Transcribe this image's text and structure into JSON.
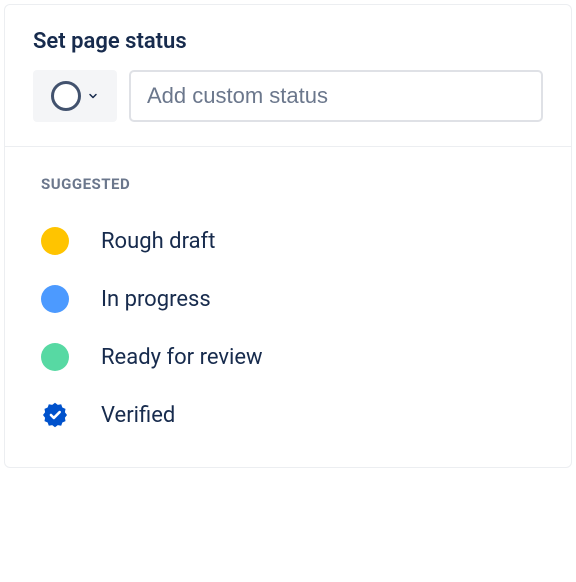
{
  "title": "Set page status",
  "input": {
    "placeholder": "Add custom status",
    "value": ""
  },
  "suggested": {
    "label": "Suggested",
    "items": [
      {
        "label": "Rough draft",
        "color": "#FFC400",
        "type": "dot"
      },
      {
        "label": "In progress",
        "color": "#4C9AFF",
        "type": "dot"
      },
      {
        "label": "Ready for review",
        "color": "#57D9A3",
        "type": "dot"
      },
      {
        "label": "Verified",
        "color": "#0052CC",
        "type": "verified"
      }
    ]
  }
}
